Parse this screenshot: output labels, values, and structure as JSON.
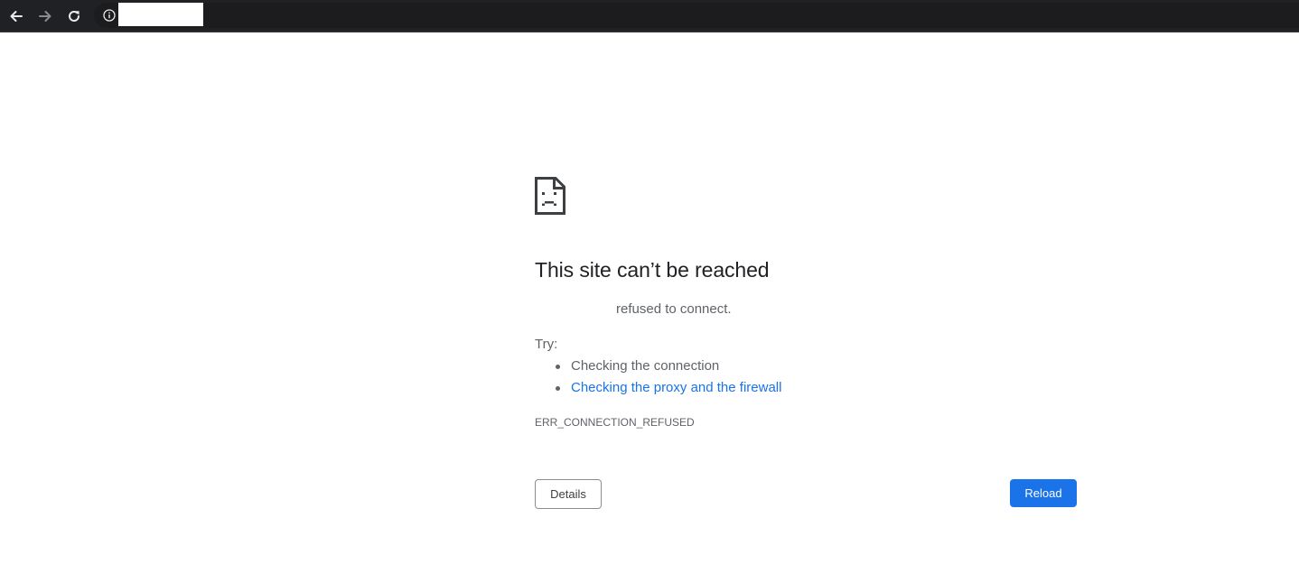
{
  "browser": {
    "nav_icons": [
      "arrow-left-icon",
      "arrow-right-icon",
      "reload-icon"
    ],
    "address_icon": "info-icon",
    "url": ""
  },
  "error_page": {
    "icon": "sad-page-icon",
    "title": "This site can’t be reached",
    "subtitle": "refused to connect.",
    "try_label": "Try:",
    "suggestions": [
      {
        "label": "Checking the connection",
        "link": false
      },
      {
        "label": "Checking the proxy and the firewall",
        "link": true
      }
    ],
    "error_code": "ERR_CONNECTION_REFUSED",
    "details_label": "Details",
    "reload_label": "Reload"
  },
  "colors": {
    "toolbar_bg": "#202124",
    "link": "#1a73e8",
    "primary_button": "#1a73e8",
    "text_primary": "#202124",
    "text_secondary": "#5f6368"
  }
}
